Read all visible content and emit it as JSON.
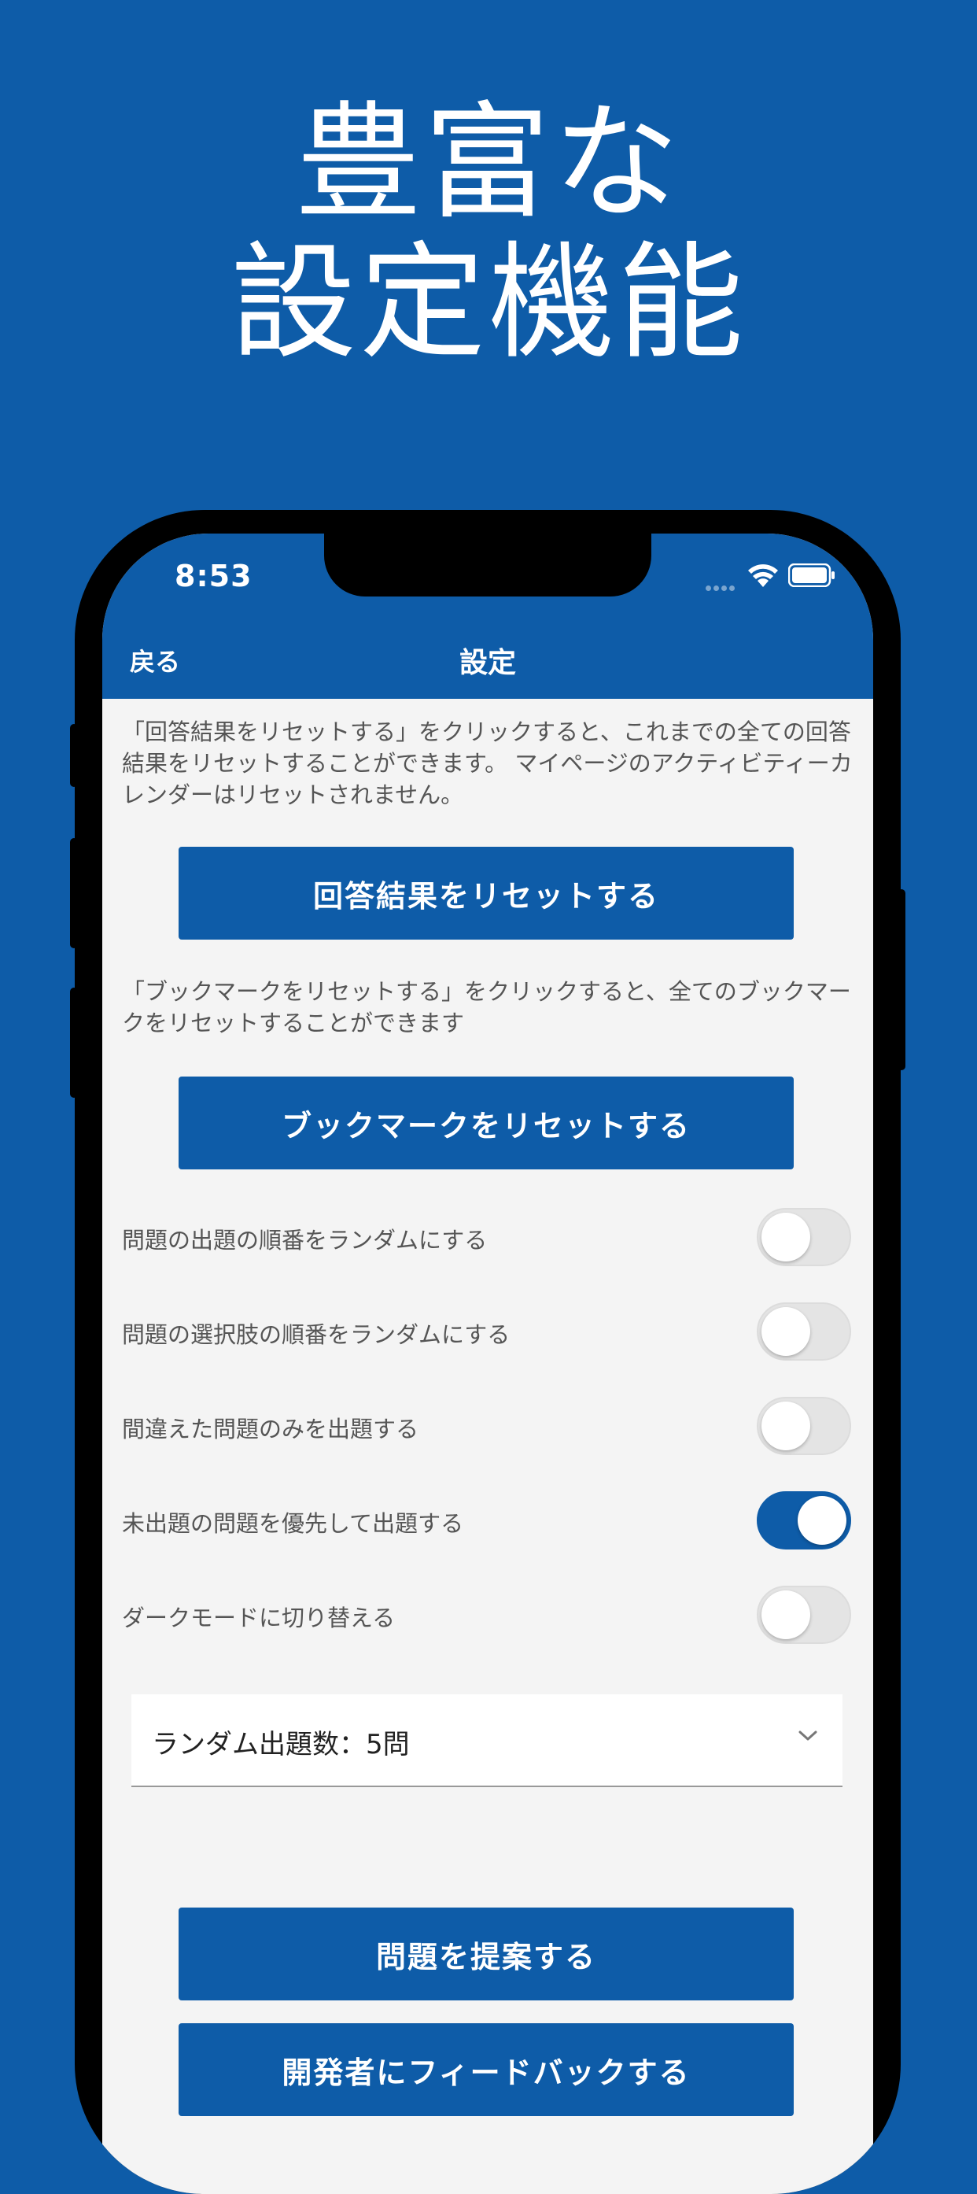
{
  "headline": {
    "line1": "豊富な",
    "line2": "設定機能"
  },
  "status_bar": {
    "time": "8:53"
  },
  "nav": {
    "back_label": "戻る",
    "title": "設定"
  },
  "reset_results": {
    "description": "「回答結果をリセットする」をクリックすると、これまでの全ての回答結果をリセットすることができます。 マイページのアクティビティーカレンダーはリセットされません。",
    "button_label": "回答結果をリセットする"
  },
  "reset_bookmarks": {
    "description": "「ブックマークをリセットする」をクリックすると、全てのブックマークをリセットすることができます",
    "button_label": "ブックマークをリセットする"
  },
  "settings": [
    {
      "label": "問題の出題の順番をランダムにする",
      "on": false
    },
    {
      "label": "問題の選択肢の順番をランダムにする",
      "on": false
    },
    {
      "label": "間違えた問題のみを出題する",
      "on": false
    },
    {
      "label": "未出題の問題を優先して出題する",
      "on": true
    },
    {
      "label": "ダークモードに切り替える",
      "on": false
    }
  ],
  "random_count": {
    "value": "ランダム出題数：5問"
  },
  "actions": {
    "suggest_label": "問題を提案する",
    "feedback_label": "開発者にフィードバックする"
  },
  "colors": {
    "brand": "#0E5CA8",
    "background": "#F4F4F4"
  }
}
